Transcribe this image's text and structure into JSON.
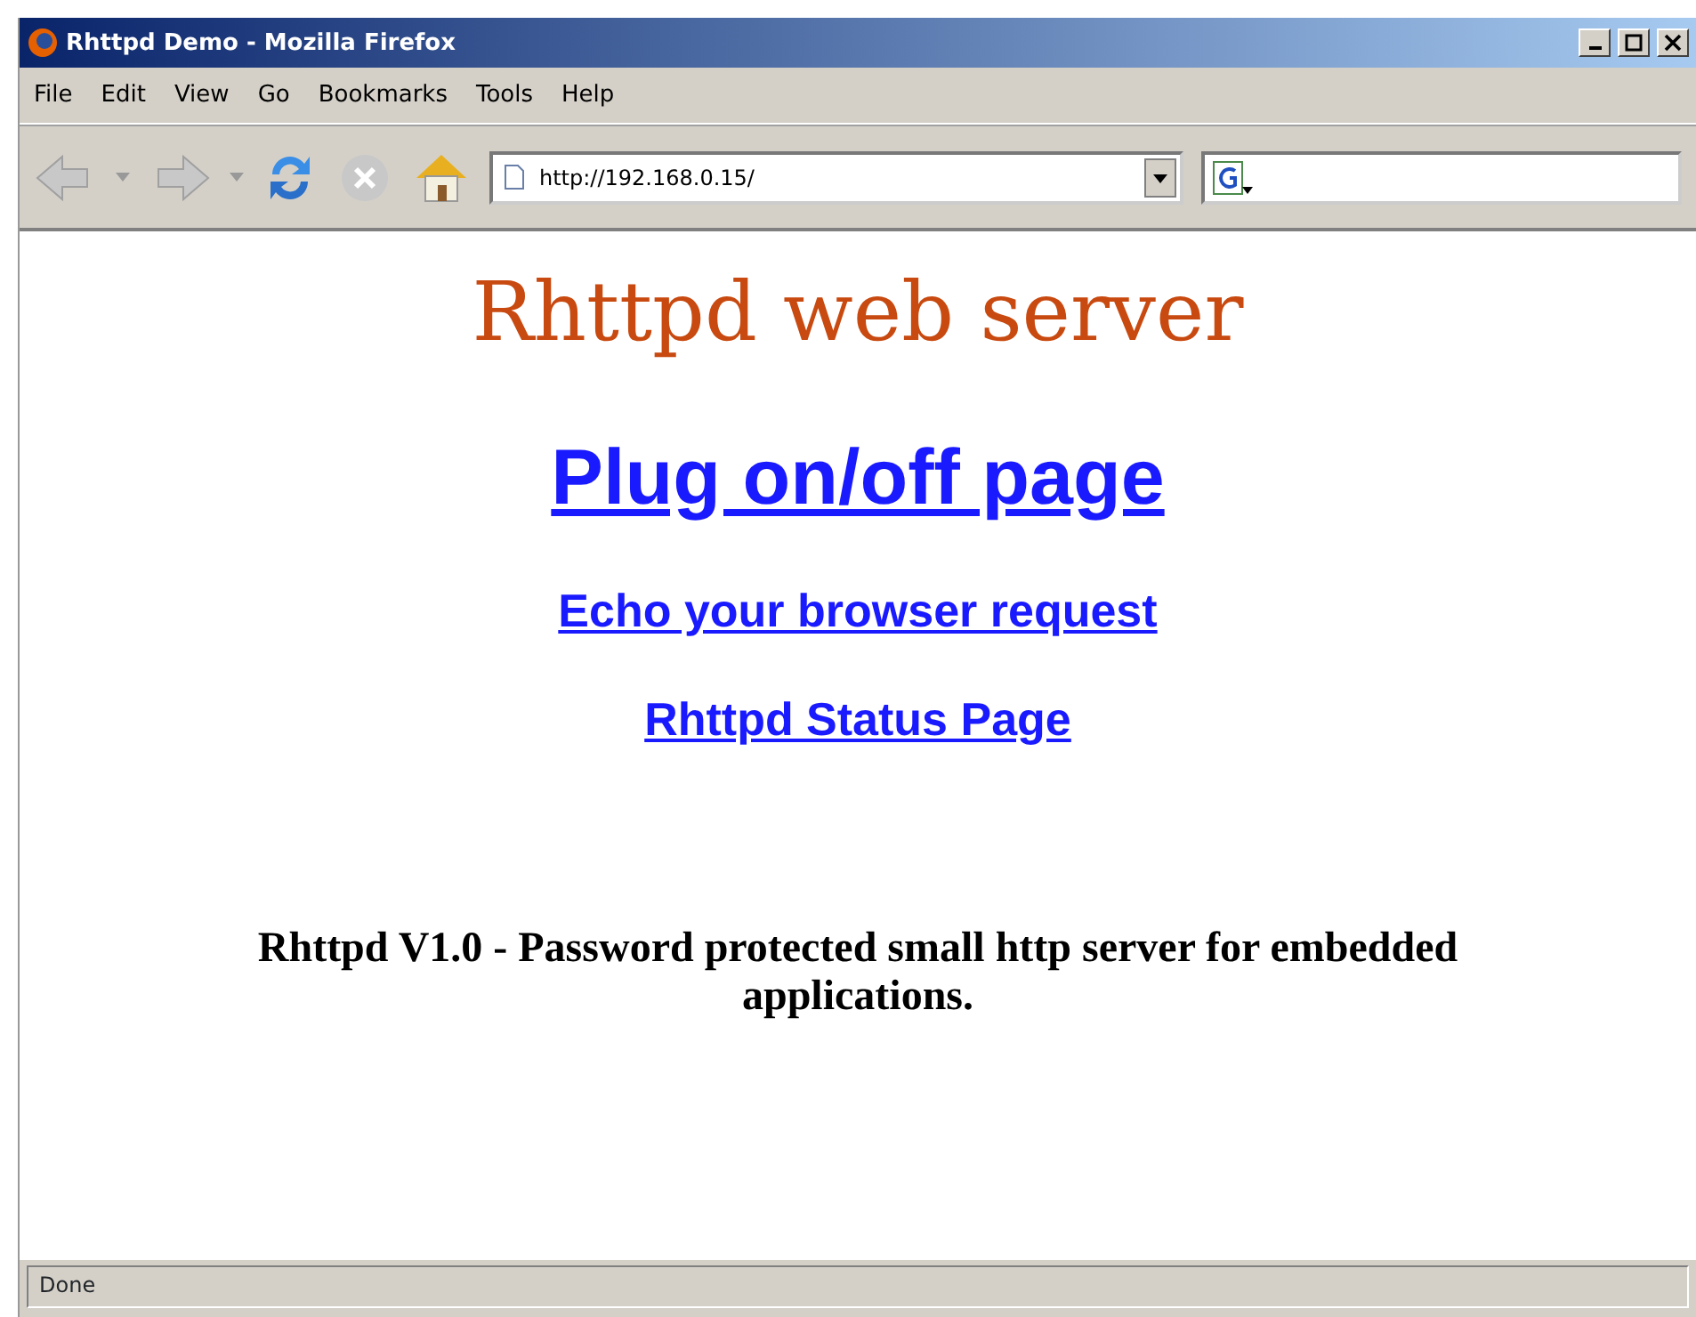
{
  "window": {
    "title": "Rhttpd Demo - Mozilla Firefox"
  },
  "menu": [
    "File",
    "Edit",
    "View",
    "Go",
    "Bookmarks",
    "Tools",
    "Help"
  ],
  "address": {
    "value": "http://192.168.0.15/"
  },
  "page": {
    "heading": "Rhttpd web server",
    "links": [
      {
        "text": "Plug on/off page",
        "kind": "main"
      },
      {
        "text": "Echo your browser request",
        "kind": "minor"
      },
      {
        "text": "Rhttpd Status Page",
        "kind": "minor"
      }
    ],
    "footer": "Rhttpd V1.0 - Password protected small http server for embedded applications."
  },
  "status_bar": {
    "text": "Done"
  }
}
